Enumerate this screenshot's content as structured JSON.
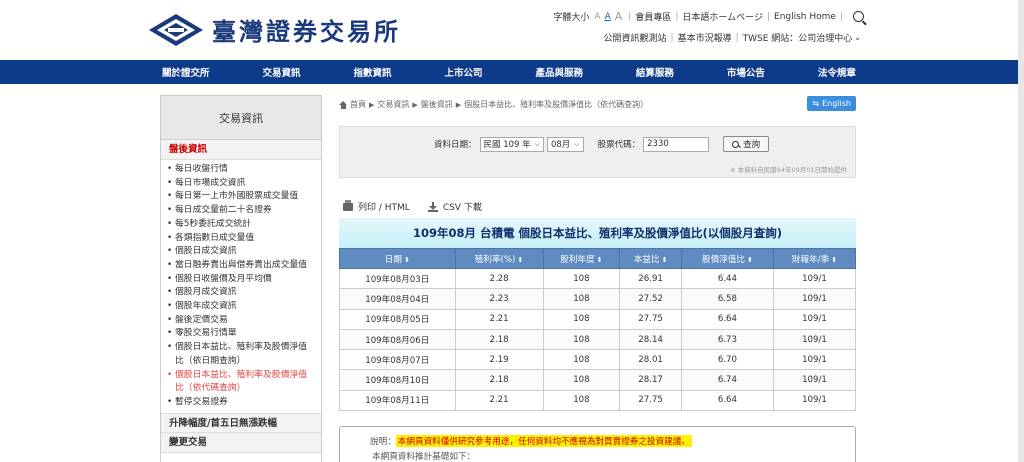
{
  "header": {
    "logo_text": "臺灣證券交易所",
    "font_size_label": "字體大小",
    "font_sizes": [
      "A",
      "A",
      "A"
    ],
    "top_links": [
      "會員專區",
      "日本語ホームページ",
      "English Home"
    ],
    "second_links": [
      "公開資訊觀測站",
      "基本市況報導",
      "TWSE 網站：公司治理中心"
    ]
  },
  "nav": {
    "items": [
      "關於證交所",
      "交易資訊",
      "指數資訊",
      "上市公司",
      "產品與服務",
      "結算服務",
      "市場公告",
      "法令規章"
    ]
  },
  "sidebar": {
    "title": "交易資訊",
    "section": "盤後資訊",
    "items": [
      "每日收盤行情",
      "每日市場成交資訊",
      "每日第一上市外國股票成交量值",
      "每日成交量前二十名證券",
      "每5秒委託成交統計",
      "各類指數日成交量值",
      "個股日成交資訊",
      "當日融券賣出與借券賣出成交量值",
      "個股日收盤價及月平均價",
      "個股月成交資訊",
      "個股年成交資訊",
      "盤後定價交易",
      "零股交易行情單",
      "個股日本益比、殖利率及股價淨值比（依日期查詢）",
      "個股日本益比、殖利率及股價淨值比（依代碼查詢）",
      "暫停交易證券"
    ],
    "active_index": 14,
    "section2": "升降幅度/首五日無漲跌幅",
    "section3": "變更交易"
  },
  "breadcrumb": {
    "items": [
      "首頁",
      "交易資訊",
      "盤後資訊",
      "個股日本益比、殖利率及股價淨值比（依代碼查詢）"
    ]
  },
  "english_button": "English",
  "query": {
    "date_label": "資料日期：",
    "year_value": "民國 109 年",
    "month_value": "08月",
    "code_label": "股票代碼：",
    "code_value": "2330",
    "button_label": "查詢",
    "note": "※ 本資料自民國94年09月01日開始提供"
  },
  "export": {
    "print_label": "列印 / HTML",
    "csv_label": "CSV 下載"
  },
  "table": {
    "title": "109年08月 台積電 個股日本益比、殖利率及股價淨值比(以個股月查詢)",
    "headers": [
      "日期",
      "殖利率(%)",
      "股利年度",
      "本益比",
      "股價淨值比",
      "財報年/季"
    ],
    "rows": [
      [
        "109年08月03日",
        "2.28",
        "108",
        "26.91",
        "6.44",
        "109/1"
      ],
      [
        "109年08月04日",
        "2.23",
        "108",
        "27.52",
        "6.58",
        "109/1"
      ],
      [
        "109年08月05日",
        "2.21",
        "108",
        "27.75",
        "6.64",
        "109/1"
      ],
      [
        "109年08月06日",
        "2.18",
        "108",
        "28.14",
        "6.73",
        "109/1"
      ],
      [
        "109年08月07日",
        "2.19",
        "108",
        "28.01",
        "6.70",
        "109/1"
      ],
      [
        "109年08月10日",
        "2.18",
        "108",
        "28.17",
        "6.74",
        "109/1"
      ],
      [
        "109年08月11日",
        "2.21",
        "108",
        "27.75",
        "6.64",
        "109/1"
      ]
    ]
  },
  "note": {
    "label": "說明：",
    "highlight": "本網頁資料僅供研究參考用途，任何資料均不應視為對買賣證券之投資建議。",
    "line2": "本網頁資料推計基礎如下："
  }
}
